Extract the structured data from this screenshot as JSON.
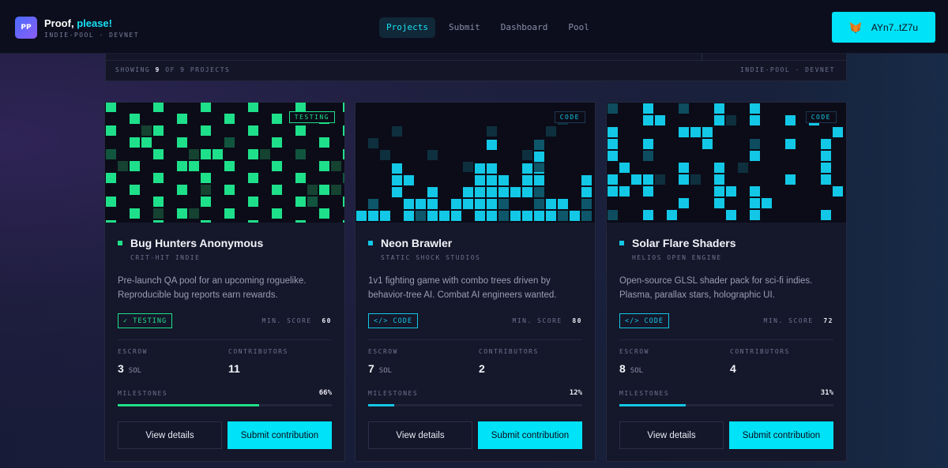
{
  "app": {
    "logo_text": "PP",
    "title_main": "Proof,",
    "title_accent": "please!",
    "subtitle": "INDIE-POOL · DEVNET"
  },
  "nav": {
    "items": [
      {
        "label": "Projects",
        "active": true
      },
      {
        "label": "Submit",
        "active": false
      },
      {
        "label": "Dashboard",
        "active": false
      },
      {
        "label": "Pool",
        "active": false
      }
    ]
  },
  "wallet": {
    "address": "AYn7..tZ7u",
    "icon": "metamask-fox-icon"
  },
  "filter": {
    "showing_prefix": "SHOWING",
    "showing_count": "9",
    "showing_mid": "OF",
    "showing_total": "9",
    "showing_suffix": "PROJECTS",
    "network": "INDIE-POOL · DEVNET"
  },
  "labels": {
    "escrow": "ESCROW",
    "contributors": "CONTRIBUTORS",
    "milestones": "MILESTONES",
    "min_score": "MIN. SCORE",
    "sol_unit": "SOL",
    "view_details": "View details",
    "submit_contribution": "Submit contribution"
  },
  "colors": {
    "accent": "#00e2f7",
    "testing": "#1fe08a",
    "code": "#13c8e6"
  },
  "projects": [
    {
      "title": "Bug Hunters Anonymous",
      "studio": "CRIT-HIT INDIE",
      "description": "Pre-launch QA pool for an upcoming roguelike. Reproducible bug reports earn rewards.",
      "tag": "TESTING",
      "badge": "✓ TESTING",
      "min_score": "60",
      "escrow": "3",
      "contributors": "11",
      "milestones_pct": "66%",
      "milestones_value": 0.66,
      "color": "#1fe08a",
      "art": "checker"
    },
    {
      "title": "Neon Brawler",
      "studio": "STATIC SHOCK STUDIOS",
      "description": "1v1 fighting game with combo trees driven by behavior-tree AI. Combat AI engineers wanted.",
      "tag": "CODE",
      "badge": "</> CODE",
      "min_score": "80",
      "escrow": "7",
      "contributors": "2",
      "milestones_pct": "12%",
      "milestones_value": 0.12,
      "color": "#13c8e6",
      "art": "bars"
    },
    {
      "title": "Solar Flare Shaders",
      "studio": "HELIOS OPEN ENGINE",
      "description": "Open-source GLSL shader pack for sci-fi indies. Plasma, parallax stars, holographic UI.",
      "tag": "CODE",
      "badge": "</> CODE",
      "min_score": "72",
      "escrow": "8",
      "contributors": "4",
      "milestones_pct": "31%",
      "milestones_value": 0.31,
      "color": "#13c8e6",
      "art": "columns"
    }
  ]
}
